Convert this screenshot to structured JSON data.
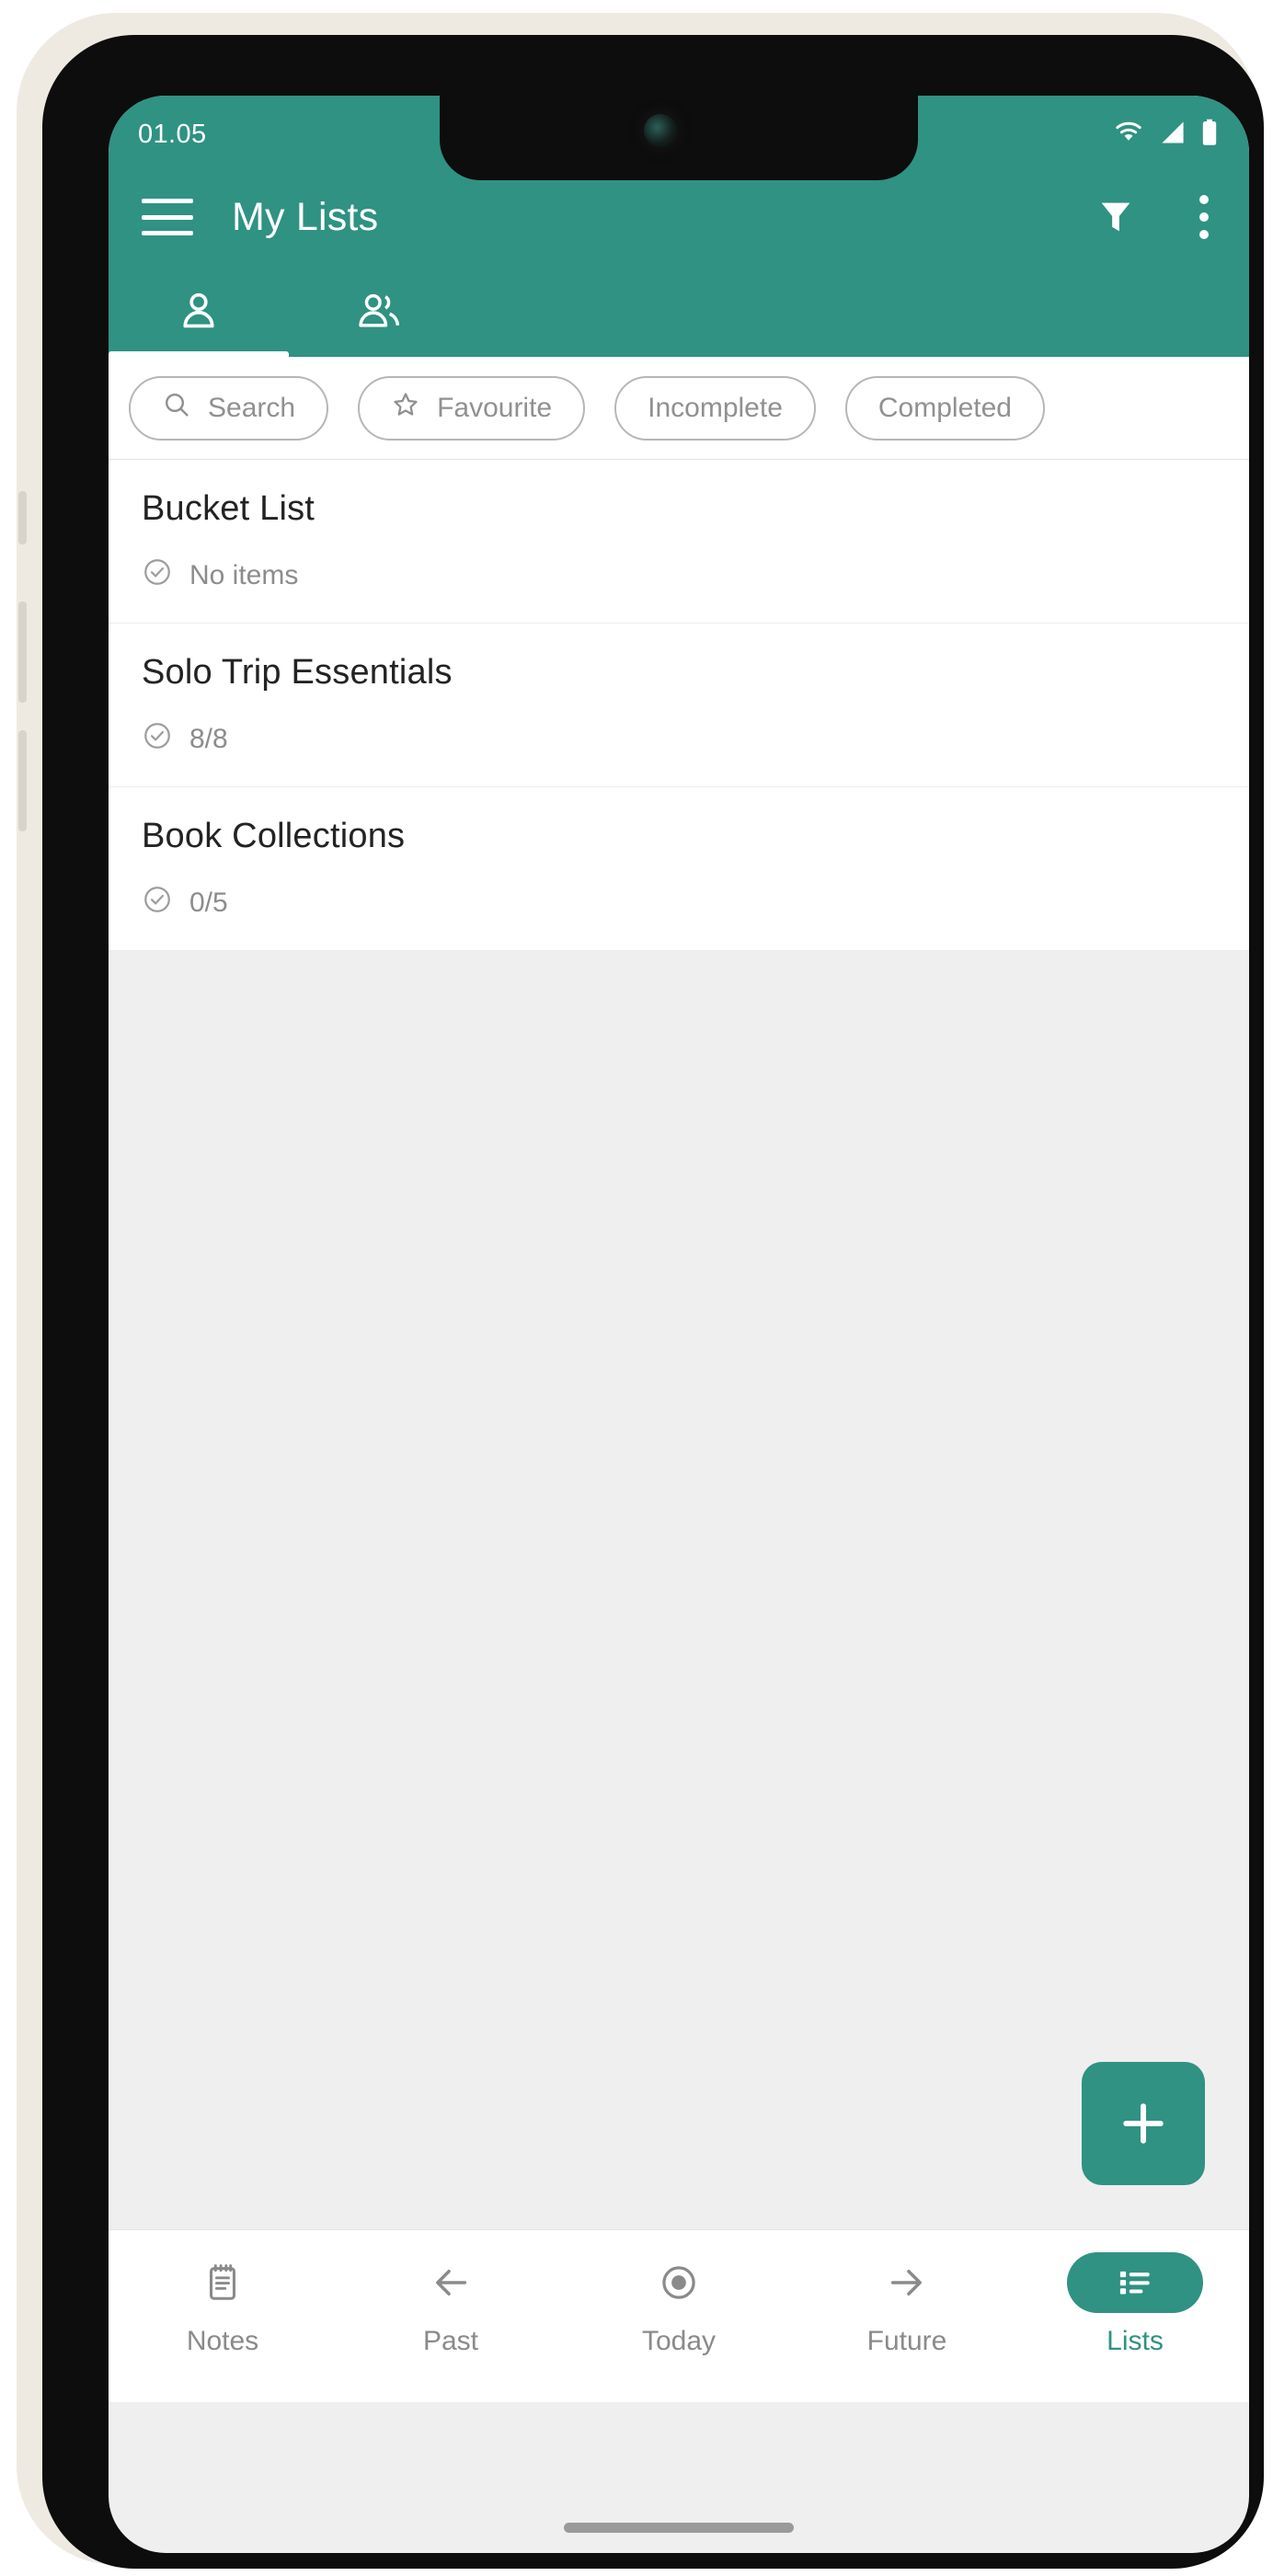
{
  "status_bar": {
    "time": "01.05",
    "icons": [
      "wifi-icon",
      "cellular-signal-icon",
      "battery-icon"
    ]
  },
  "app_bar": {
    "menu_icon": "hamburger-menu-icon",
    "title": "My Lists",
    "filter_icon": "filter-funnel-icon",
    "overflow_icon": "more-vertical-icon"
  },
  "tabs": [
    {
      "name": "personal",
      "icon": "person-icon",
      "active": true
    },
    {
      "name": "shared",
      "icon": "people-group-icon",
      "active": false
    }
  ],
  "chips": [
    {
      "label": "Search",
      "icon": "search-icon"
    },
    {
      "label": "Favourite",
      "icon": "star-icon"
    },
    {
      "label": "Incomplete",
      "icon": ""
    },
    {
      "label": "Completed",
      "icon": ""
    }
  ],
  "lists": [
    {
      "title": "Bucket List",
      "progress": "No items",
      "icon": "check-circle-icon"
    },
    {
      "title": "Solo Trip Essentials",
      "progress": "8/8",
      "icon": "check-circle-icon"
    },
    {
      "title": "Book Collections",
      "progress": "0/5",
      "icon": "check-circle-icon"
    }
  ],
  "fab": {
    "icon": "plus-icon",
    "label": ""
  },
  "bottom_nav": [
    {
      "label": "Notes",
      "icon": "notepad-icon",
      "active": false
    },
    {
      "label": "Past",
      "icon": "arrow-left-icon",
      "active": false
    },
    {
      "label": "Today",
      "icon": "target-circle-icon",
      "active": false
    },
    {
      "label": "Future",
      "icon": "arrow-right-icon",
      "active": false
    },
    {
      "label": "Lists",
      "icon": "list-icon",
      "active": true
    }
  ],
  "colors": {
    "primary": "#2f9283",
    "background": "#efefef",
    "surface": "#ffffff",
    "text_primary": "#232323",
    "text_secondary": "#8c8c8c",
    "chip_border": "#b6b6b6"
  }
}
